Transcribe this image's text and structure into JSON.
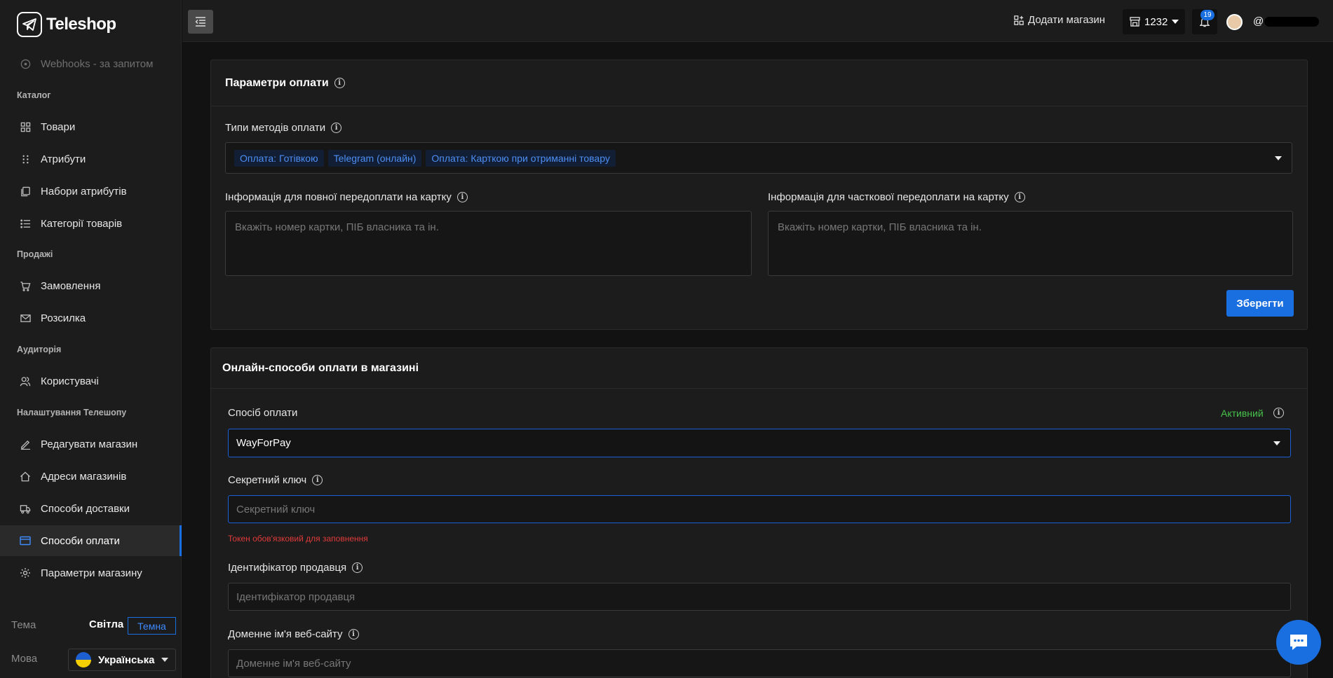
{
  "app": {
    "brand": "Teleshop"
  },
  "sidebar": {
    "webhooks": "Webhooks - за запитом",
    "sections": {
      "catalog": "Каталог",
      "sales": "Продажі",
      "audience": "Аудиторія",
      "settings": "Налаштування Телешопу"
    },
    "items": {
      "goods": "Товари",
      "attributes": "Атрибути",
      "attribute_sets": "Набори атрибутів",
      "categories": "Категорії товарів",
      "orders": "Замовлення",
      "mailing": "Розсилка",
      "users": "Користувачі",
      "edit_shop": "Редагувати магазин",
      "shop_addresses": "Адреси магазинів",
      "delivery": "Способи доставки",
      "payment": "Способи оплати",
      "shop_params": "Параметри магазину"
    },
    "theme": {
      "label": "Тема",
      "light": "Світла",
      "dark": "Темна"
    },
    "language": {
      "label": "Мова",
      "value": "Українська"
    }
  },
  "topbar": {
    "add_shop": "Додати магазин",
    "store_id": "1232",
    "notifications_count": "19",
    "username": "@"
  },
  "payment_params": {
    "title": "Параметри оплати",
    "types_label": "Типи методів оплати",
    "types_selected": [
      "Оплата: Готівкою",
      "Telegram (онлайн)",
      "Оплата: Карткою при отриманні товару"
    ],
    "full_prepay_label": "Інформація для повної передоплати на картку",
    "full_prepay_placeholder": "Вкажіть номер картки, ПІБ власника та ін.",
    "partial_prepay_label": "Інформація для часткової передоплати на картку",
    "partial_prepay_placeholder": "Вкажіть номер картки, ПІБ власника та ін.",
    "save": "Зберегти"
  },
  "online_payment": {
    "title": "Онлайн-способи оплати в магазині",
    "method_label": "Спосіб оплати",
    "status": "Активний",
    "method_value": "WayForPay",
    "secret_label": "Секретний ключ",
    "secret_placeholder": "Секретний ключ",
    "secret_error": "Токен обов'язковий для заповнення",
    "merchant_label": "Ідентифікатор продавця",
    "merchant_placeholder": "Ідентифікатор продавця",
    "domain_label": "Доменне ім'я веб-сайту",
    "domain_placeholder": "Доменне ім'я веб-сайту"
  },
  "colors": {
    "accent": "#1a6fe0",
    "active": "#46c24a",
    "error": "#e03a3a"
  }
}
